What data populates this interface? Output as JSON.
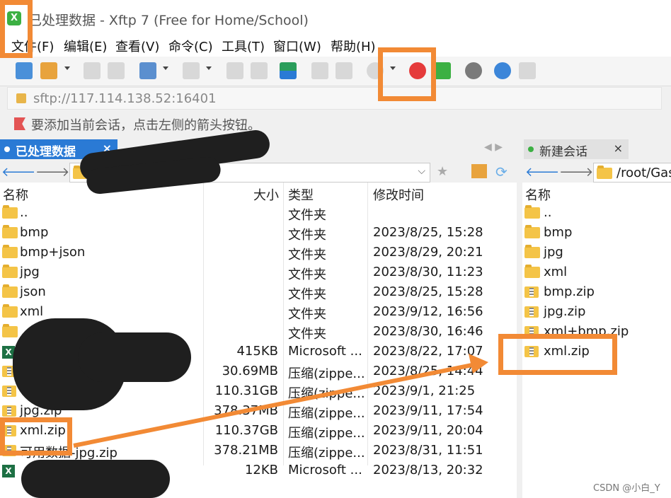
{
  "window": {
    "title": "已处理数据 - Xftp 7 (Free for Home/School)",
    "app_icon_glyph": "X"
  },
  "menu": [
    "文件(F)",
    "编辑(E)",
    "查看(V)",
    "命令(C)",
    "工具(T)",
    "窗口(W)",
    "帮助(H)"
  ],
  "toolbar": {
    "icons": [
      "new-session-icon",
      "open-folder-icon",
      "disconnect-icon",
      "reconnect-icon",
      "transfer-settings-icon",
      "view-icon",
      "sync-icon",
      "transfer-icon",
      "copy-icon",
      "paste-icon",
      "xshell-icon",
      "xftp-icon",
      "settings-icon",
      "help-icon",
      "chat-icon"
    ]
  },
  "address": {
    "value": "sftp://117.114.138.52:16401"
  },
  "hint": {
    "text": "要添加当前会话，点击左侧的箭头按钮。"
  },
  "left_pane": {
    "tab_label": "已处理数据",
    "tab_close": "×",
    "columns": {
      "name": "名称",
      "size": "大小",
      "type": "类型",
      "modified": "修改时间"
    },
    "rows": [
      {
        "icon": "folder",
        "name": "..",
        "size": "",
        "type": "文件夹",
        "modified": ""
      },
      {
        "icon": "folder",
        "name": "bmp",
        "size": "",
        "type": "文件夹",
        "modified": "2023/8/25, 15:28"
      },
      {
        "icon": "folder",
        "name": "bmp+json",
        "size": "",
        "type": "文件夹",
        "modified": "2023/8/29, 20:21"
      },
      {
        "icon": "folder",
        "name": "jpg",
        "size": "",
        "type": "文件夹",
        "modified": "2023/8/30, 11:23"
      },
      {
        "icon": "folder",
        "name": "json",
        "size": "",
        "type": "文件夹",
        "modified": "2023/8/25, 15:28"
      },
      {
        "icon": "folder",
        "name": "xml",
        "size": "",
        "type": "文件夹",
        "modified": "2023/9/12, 16:56"
      },
      {
        "icon": "folder",
        "name": "",
        "size": "",
        "type": "文件夹",
        "modified": "2023/8/30, 16:46"
      },
      {
        "icon": "xls",
        "name": "",
        "size": "415KB",
        "type": "Microsoft ...",
        "modified": "2023/8/22, 17:07"
      },
      {
        "icon": "zip",
        "name": "",
        "size": "30.69MB",
        "type": "压缩(zippe...",
        "modified": "2023/8/25, 14:44"
      },
      {
        "icon": "zip",
        "name": "",
        "size": "110.31GB",
        "type": "压缩(zippe...",
        "modified": "2023/9/1, 21:25"
      },
      {
        "icon": "zip",
        "name": "jpg.zip",
        "size": "378.37MB",
        "type": "压缩(zippe...",
        "modified": "2023/9/11, 17:54"
      },
      {
        "icon": "zip",
        "name": "xml.zip",
        "size": "110.37GB",
        "type": "压缩(zippe...",
        "modified": "2023/9/11, 20:04"
      },
      {
        "icon": "zip",
        "name": "可用数据-jpg.zip",
        "size": "378.21MB",
        "type": "压缩(zippe...",
        "modified": "2023/8/31, 11:51"
      },
      {
        "icon": "xls",
        "name": "",
        "size": "12KB",
        "type": "Microsoft ...",
        "modified": "2023/8/13, 20:32"
      }
    ]
  },
  "right_pane": {
    "tab_label": "新建会话",
    "tab_close": "×",
    "path": "/root/Gas",
    "columns": {
      "name": "名称"
    },
    "rows": [
      {
        "icon": "folder",
        "name": ".."
      },
      {
        "icon": "folder",
        "name": "bmp"
      },
      {
        "icon": "folder",
        "name": "jpg"
      },
      {
        "icon": "folder",
        "name": "xml"
      },
      {
        "icon": "zip",
        "name": "bmp.zip"
      },
      {
        "icon": "zip",
        "name": "jpg.zip"
      },
      {
        "icon": "zip",
        "name": "xml+bmp.zip"
      },
      {
        "icon": "zip",
        "name": "xml.zip"
      }
    ]
  },
  "watermark": "CSDN @小白_Y",
  "colors": {
    "accent": "#2a7ad5",
    "highlight": "#f28a35",
    "tab_dot": "#3cb043"
  }
}
